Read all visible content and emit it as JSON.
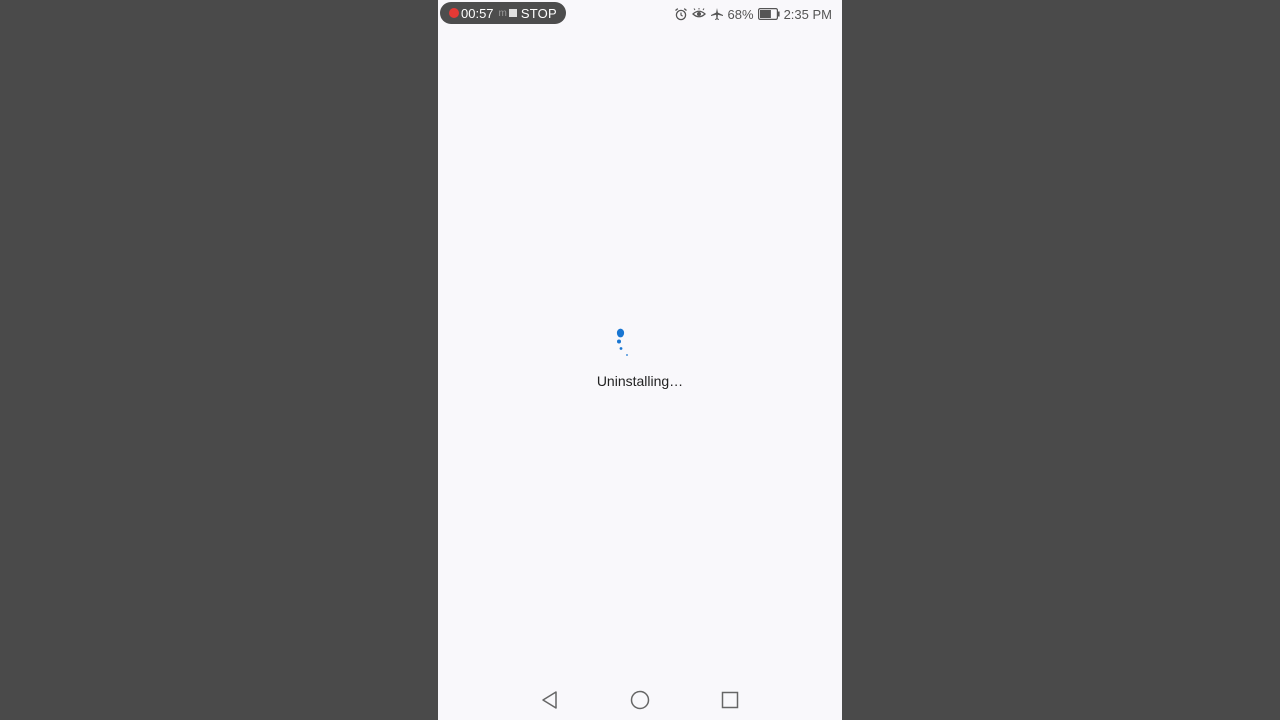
{
  "recorder": {
    "elapsed": "00:57",
    "ghost_text": "m",
    "stop_label": "STOP",
    "dot_color": "#e53935"
  },
  "status_bar": {
    "icons": [
      "alarm-icon",
      "eye-comfort-icon",
      "airplane-mode-icon",
      "battery-icon"
    ],
    "battery_percent": "68%",
    "battery_level": 0.68,
    "time": "2:35 PM"
  },
  "main": {
    "message": "Uninstalling…",
    "spinner_color": "#1976d2"
  },
  "nav_bar": {
    "buttons": [
      "back-icon",
      "home-icon",
      "recent-apps-icon"
    ]
  }
}
